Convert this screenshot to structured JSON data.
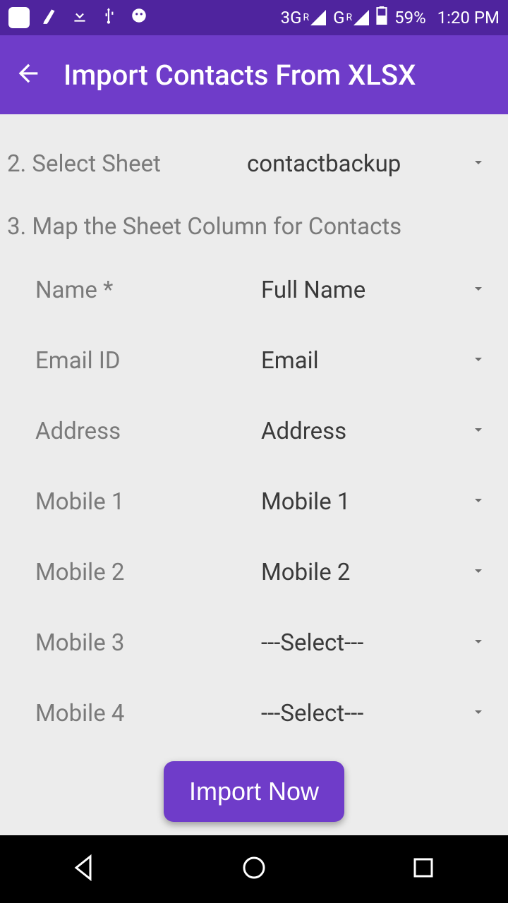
{
  "status": {
    "network1": "3G",
    "network1_sup": "R",
    "network2": "G",
    "network2_sup": "R",
    "battery": "59%",
    "time": "1:20 PM"
  },
  "appbar": {
    "title": "Import Contacts From XLSX"
  },
  "step2": {
    "label": "2. Select Sheet",
    "value": "contactbackup"
  },
  "step3": {
    "label": "3. Map the Sheet Column for Contacts"
  },
  "fields": [
    {
      "label": "Name *",
      "value": "Full Name"
    },
    {
      "label": "Email ID",
      "value": "Email"
    },
    {
      "label": "Address",
      "value": "Address"
    },
    {
      "label": "Mobile 1",
      "value": "Mobile 1"
    },
    {
      "label": "Mobile 2",
      "value": "Mobile 2"
    },
    {
      "label": "Mobile 3",
      "value": "---Select---"
    },
    {
      "label": "Mobile 4",
      "value": "---Select---"
    }
  ],
  "importButton": "Import Now"
}
